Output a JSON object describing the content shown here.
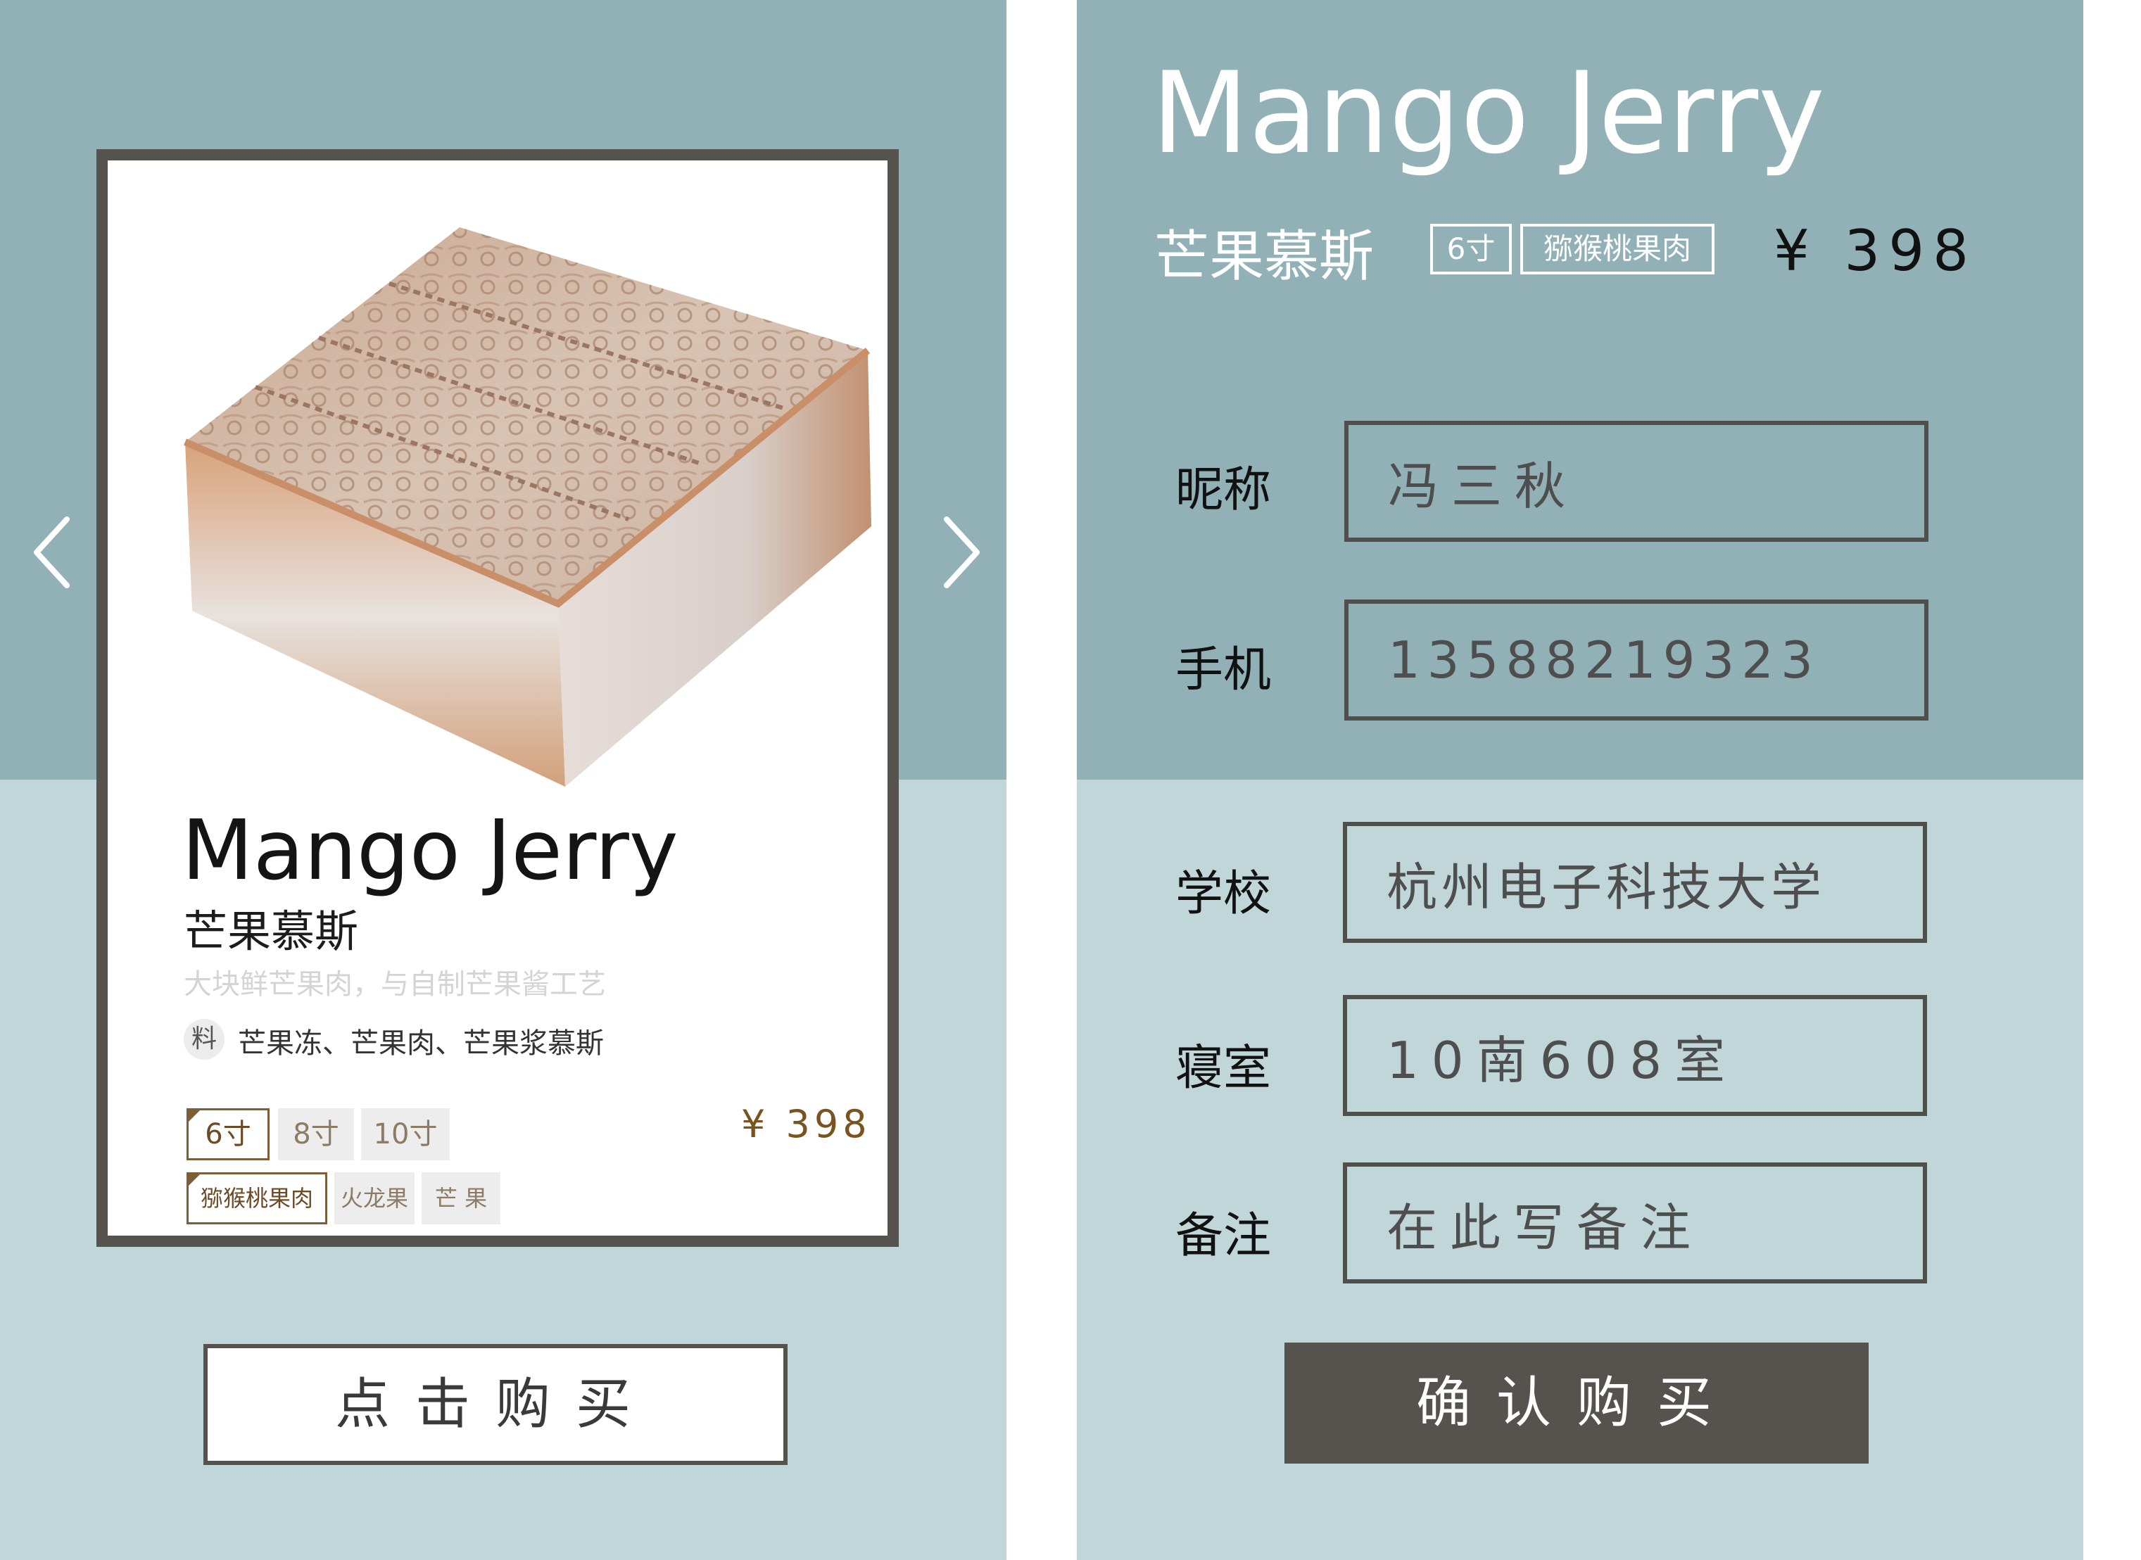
{
  "left": {
    "product_image": "stamped-mousse-cake",
    "title": "Mango Jerry",
    "subtitle": "芒果慕斯",
    "description": "大块鲜芒果肉，与自制芒果酱工艺",
    "ingredients_icon": "料",
    "ingredients": "芒果冻、芒果肉、芒果浆慕斯",
    "sizes": [
      {
        "label": "6寸",
        "selected": true
      },
      {
        "label": "8寸",
        "selected": false
      },
      {
        "label": "10寸",
        "selected": false
      }
    ],
    "flavors": [
      {
        "label": "猕猴桃果肉",
        "selected": true
      },
      {
        "label": "火龙果",
        "selected": false
      },
      {
        "label": "芒 果",
        "selected": false
      }
    ],
    "price": "¥ 398",
    "prev_icon": "chevron-left-icon",
    "next_icon": "chevron-right-icon",
    "buy_label": "点击购买"
  },
  "right": {
    "title": "Mango Jerry",
    "subtitle": "芒果慕斯",
    "size_tag": "6寸",
    "flavor_tag": "猕猴桃果肉",
    "price": "¥ 398",
    "form": {
      "nickname": {
        "label": "昵称",
        "value": "冯三秋"
      },
      "phone": {
        "label": "手机",
        "value": "13588219323"
      },
      "school": {
        "label": "学校",
        "value": "杭州电子科技大学"
      },
      "dorm": {
        "label": "寝室",
        "value": "10南608室"
      },
      "note": {
        "label": "备注",
        "value": "在此写备注"
      }
    },
    "confirm_label": "确认购买"
  },
  "colors": {
    "teal_dark": "#91b1b6",
    "teal_light": "#c0d6d9",
    "frame_dark": "#56524d",
    "price_brown": "#7a5420"
  }
}
